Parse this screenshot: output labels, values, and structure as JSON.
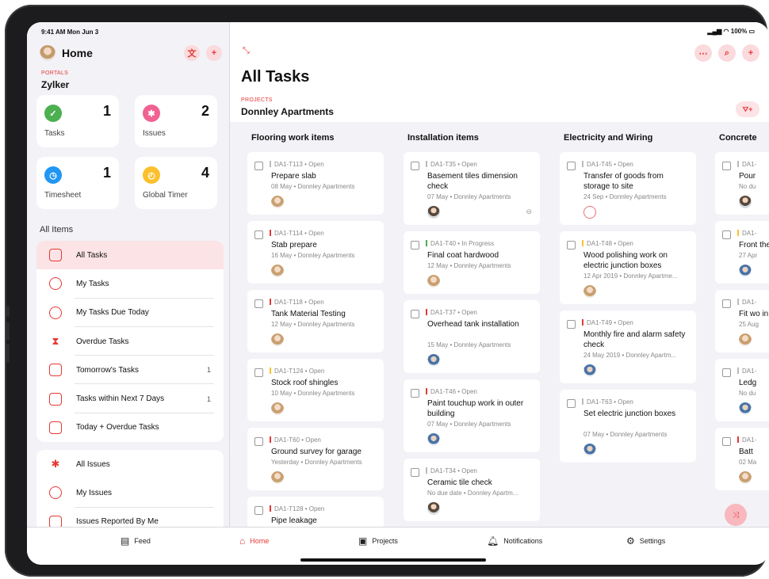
{
  "status": {
    "time": "9:41 AM  Mon Jun 3",
    "battery": "100%"
  },
  "sidebar": {
    "home_title": "Home",
    "portal_label": "PORTALS",
    "portal_name": "Zylker",
    "tiles": [
      {
        "label": "Tasks",
        "count": "1",
        "icon": "check-square-icon",
        "color": "#4caf50"
      },
      {
        "label": "Issues",
        "count": "2",
        "icon": "bug-icon",
        "color": "#f06292"
      },
      {
        "label": "Timesheet",
        "count": "1",
        "icon": "clock-icon",
        "color": "#2196f3"
      },
      {
        "label": "Global Timer",
        "count": "4",
        "icon": "timer-icon",
        "color": "#fbc02d"
      }
    ],
    "all_items_header": "All Items",
    "task_menu": [
      {
        "label": "All Tasks",
        "count": ""
      },
      {
        "label": "My Tasks",
        "count": ""
      },
      {
        "label": "My Tasks Due Today",
        "count": ""
      },
      {
        "label": "Overdue Tasks",
        "count": ""
      },
      {
        "label": "Tomorrow's Tasks",
        "count": "1"
      },
      {
        "label": "Tasks within Next 7 Days",
        "count": "1"
      },
      {
        "label": "Today + Overdue Tasks",
        "count": ""
      }
    ],
    "issue_menu": [
      {
        "label": "All Issues"
      },
      {
        "label": "My Issues"
      },
      {
        "label": "Issues Reported By Me"
      }
    ]
  },
  "main": {
    "title": "All Tasks",
    "project_label": "PROJECTS",
    "project_name": "Donnley Apartments"
  },
  "columns": [
    {
      "title": "Flooring work items",
      "cards": [
        {
          "id": "DA1-T113",
          "status": "Open",
          "title": "Prepare slab",
          "sub": "08 May • Donnley Apartments",
          "prio": "#bbbbbb",
          "av": "a"
        },
        {
          "id": "DA1-T114",
          "status": "Open",
          "title": "Stab prepare",
          "sub": "16 May • Donnley Apartments",
          "prio": "#e53935",
          "av": "a"
        },
        {
          "id": "DA1-T118",
          "status": "Open",
          "title": "Tank Material Testing",
          "sub": "12 May • Donnley Apartments",
          "prio": "#e53935",
          "av": "a"
        },
        {
          "id": "DA1-T124",
          "status": "Open",
          "title": "Stock roof shingles",
          "sub": "10 May • Donnley Apartments",
          "prio": "#fbc02d",
          "av": "a"
        },
        {
          "id": "DA1-T60",
          "status": "Open",
          "title": "Ground survey for garage",
          "sub": "Yesterday • Donnley Apartments",
          "prio": "#e53935",
          "av": "a"
        },
        {
          "id": "DA1-T128",
          "status": "Open",
          "title": "Pipe leakage",
          "sub": "",
          "prio": "#e53935",
          "av": ""
        }
      ]
    },
    {
      "title": "Installation items",
      "cards": [
        {
          "id": "DA1-T35",
          "status": "Open",
          "title": "Basement tiles dimension check",
          "sub": "07 May • Donnley Apartments",
          "prio": "#bbbbbb",
          "av": "b",
          "tag": "⊖"
        },
        {
          "id": "DA1-T40",
          "status": "In Progress",
          "title": "Final coat hardwood",
          "sub": "12 May • Donnley Apartments",
          "prio": "#4caf50",
          "av": "a"
        },
        {
          "id": "DA1-T37",
          "status": "Open",
          "title": "Overhead tank installation",
          "sub": "15 May • Donnley Apartments",
          "prio": "#e53935",
          "av": "c"
        },
        {
          "id": "DA1-T46",
          "status": "Open",
          "title": "Paint touchup work in outer building",
          "sub": "07 May • Donnley Apartments",
          "prio": "#e53935",
          "av": "c"
        },
        {
          "id": "DA1-T34",
          "status": "Open",
          "title": "Ceramic tile check",
          "sub": "No due date • Donnley Apartm...",
          "prio": "#bbbbbb",
          "av": "b"
        }
      ]
    },
    {
      "title": "Electricity and Wiring",
      "cards": [
        {
          "id": "DA1-T45",
          "status": "Open",
          "title": "Transfer of goods from storage to site",
          "sub": "24 Sep • Donnley Apartments",
          "prio": "#bbbbbb",
          "av": "d"
        },
        {
          "id": "DA1-T48",
          "status": "Open",
          "title": "Wood polishing work on electric junction boxes",
          "sub": "12 Apr 2019 • Donnley Apartme...",
          "prio": "#fbc02d",
          "av": "a"
        },
        {
          "id": "DA1-T49",
          "status": "Open",
          "title": "Monthly fire and alarm safety check",
          "sub": "24 May 2019 • Donnley Apartm...",
          "prio": "#e53935",
          "av": "c"
        },
        {
          "id": "DA1-T63",
          "status": "Open",
          "title": "Set electric junction boxes",
          "sub": "07 May • Donnley Apartments",
          "prio": "#bbbbbb",
          "av": "c"
        }
      ]
    },
    {
      "title": "Concrete",
      "cards": [
        {
          "id": "DA1-",
          "status": "",
          "title": "Pour",
          "sub": "No du",
          "prio": "#bbbbbb",
          "av": "b"
        },
        {
          "id": "DA1-",
          "status": "",
          "title": "Front the cl",
          "sub": "27 Apr",
          "prio": "#fbc02d",
          "av": "c"
        },
        {
          "id": "DA1-",
          "status": "",
          "title": "Fit wo in lotu",
          "sub": "25 Aug",
          "prio": "#bbbbbb",
          "av": "a"
        },
        {
          "id": "DA1-",
          "status": "",
          "title": "Ledg",
          "sub": "No du",
          "prio": "#bbbbbb",
          "av": "c"
        },
        {
          "id": "DA1-",
          "status": "",
          "title": "Batt",
          "sub": "02 Ma",
          "prio": "#e53935",
          "av": "a"
        }
      ]
    }
  ],
  "tabbar": {
    "feed": "Feed",
    "home": "Home",
    "projects": "Projects",
    "notifications": "Notifications",
    "settings": "Settings"
  },
  "colors": {
    "accent": "#e53935"
  }
}
